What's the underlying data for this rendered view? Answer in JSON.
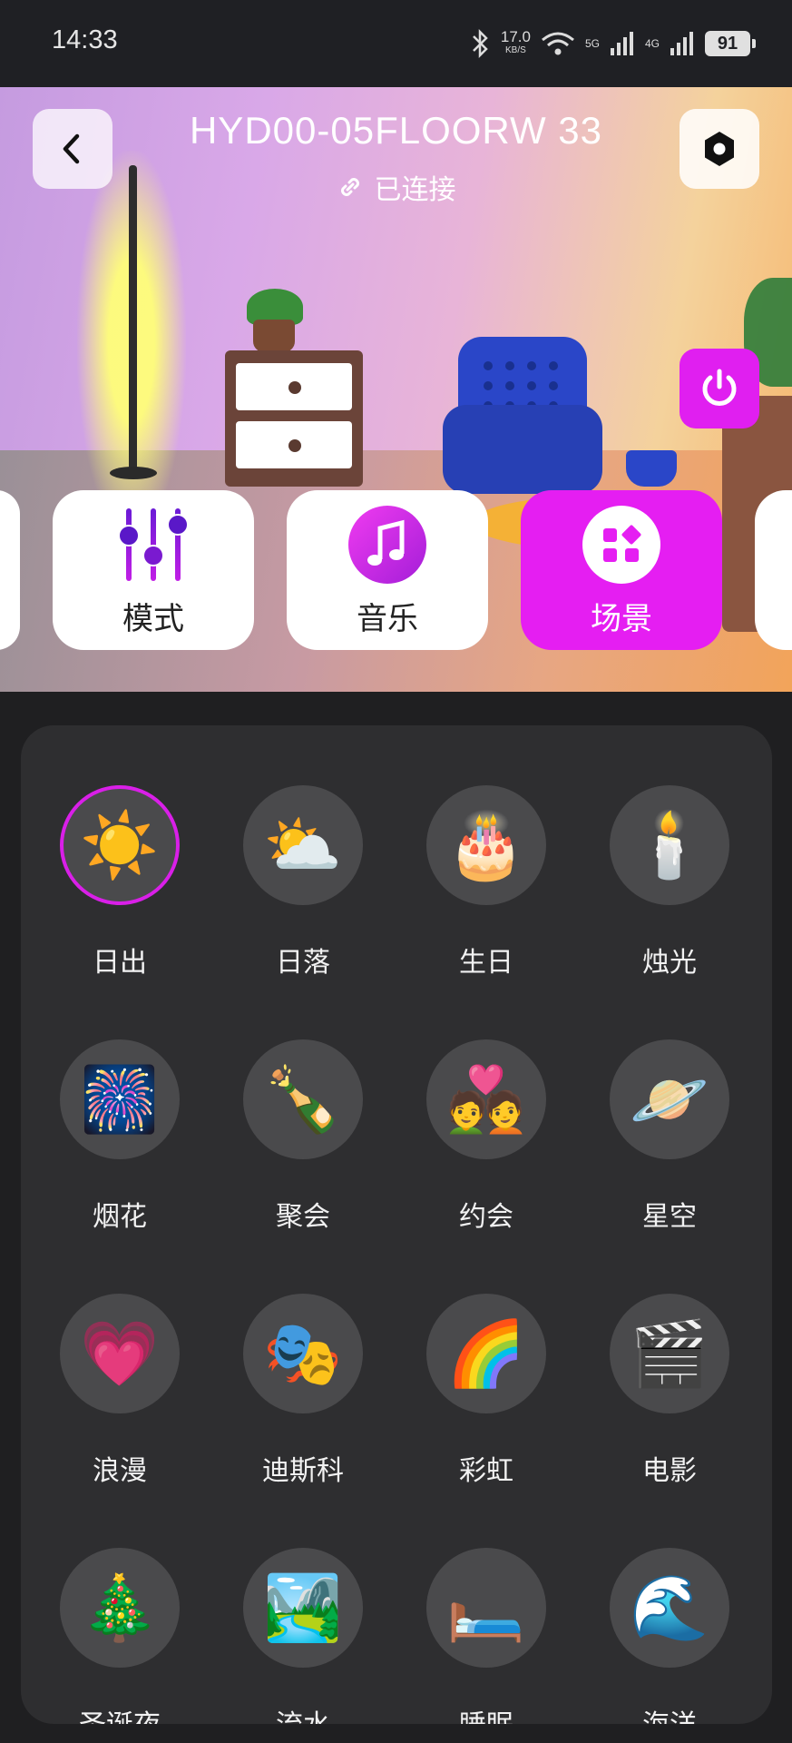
{
  "status_bar": {
    "time": "14:33",
    "net_speed": "17.0",
    "net_speed_unit": "KB/S",
    "net1": "5G",
    "net2": "4G",
    "battery": "91"
  },
  "header": {
    "title": "HYD00-05FLOORW 33",
    "status": "已连接"
  },
  "tabs": [
    {
      "label": "模式",
      "icon": "sliders-icon"
    },
    {
      "label": "音乐",
      "icon": "music-note-icon"
    },
    {
      "label": "场景",
      "icon": "grid-apps-icon",
      "active": true
    }
  ],
  "colors": {
    "accent": "#E51EF2",
    "panel": "#2E2E30",
    "background": "#1F1F21"
  },
  "scenes": [
    {
      "label": "日出",
      "icon": "☀️",
      "selected": true
    },
    {
      "label": "日落",
      "icon": "⛅"
    },
    {
      "label": "生日",
      "icon": "🎂"
    },
    {
      "label": "烛光",
      "icon": "🕯️"
    },
    {
      "label": "烟花",
      "icon": "🎆"
    },
    {
      "label": "聚会",
      "icon": "🍾"
    },
    {
      "label": "约会",
      "icon": "💑"
    },
    {
      "label": "星空",
      "icon": "🪐"
    },
    {
      "label": "浪漫",
      "icon": "💗"
    },
    {
      "label": "迪斯科",
      "icon": "🎭"
    },
    {
      "label": "彩虹",
      "icon": "🌈"
    },
    {
      "label": "电影",
      "icon": "🎬"
    },
    {
      "label": "圣诞夜",
      "icon": "🎄"
    },
    {
      "label": "流水",
      "icon": "🏞️"
    },
    {
      "label": "睡眠",
      "icon": "🛏️"
    },
    {
      "label": "海洋",
      "icon": "🌊"
    }
  ]
}
